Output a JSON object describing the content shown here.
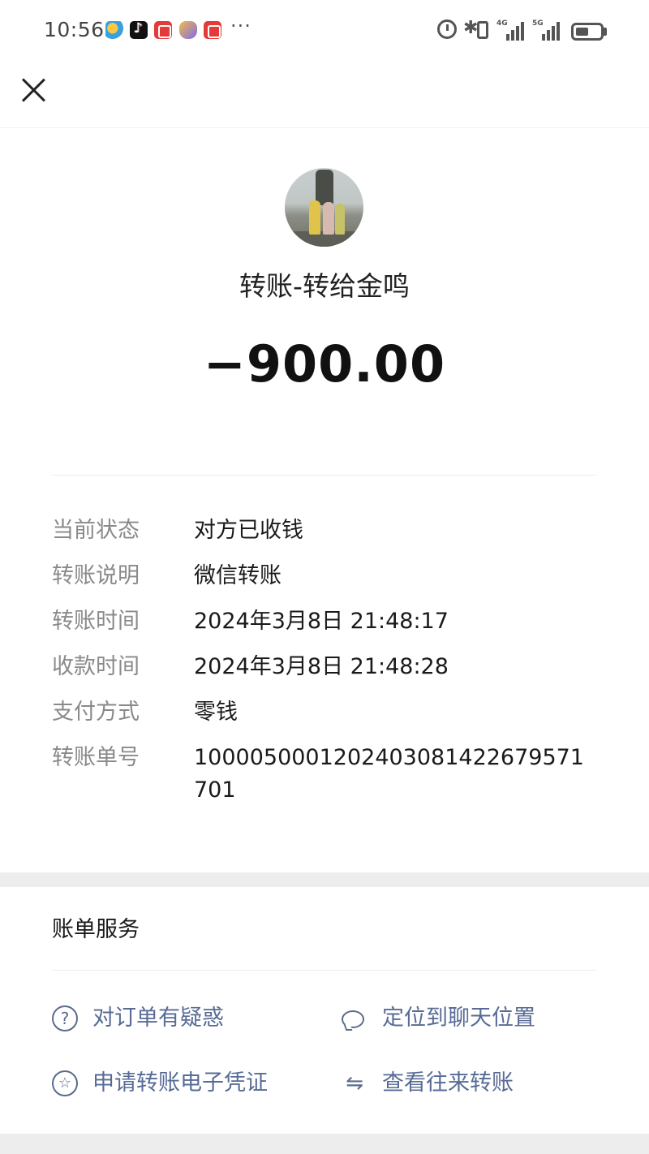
{
  "status_bar": {
    "time": "10:56",
    "more": "···",
    "network_1": "4G",
    "network_2": "5G",
    "notification_icons": [
      "app-icon",
      "tiktok-icon",
      "app-icon",
      "game-icon",
      "app-icon"
    ],
    "battery_level": 0.55
  },
  "header": {
    "close_icon": "close-icon"
  },
  "transfer": {
    "title": "转账-转给金鸣",
    "amount": "−900.00"
  },
  "details": [
    {
      "label": "当前状态",
      "value": "对方已收钱"
    },
    {
      "label": "转账说明",
      "value": "微信转账"
    },
    {
      "label": "转账时间",
      "value": "2024年3月8日 21:48:17"
    },
    {
      "label": "收款时间",
      "value": "2024年3月8日 21:48:28"
    },
    {
      "label": "支付方式",
      "value": "零钱"
    },
    {
      "label": "转账单号",
      "value": "1000050001202403081422679571701"
    }
  ],
  "services": {
    "title": "账单服务",
    "items": [
      {
        "label": "对订单有疑惑",
        "icon": "question-circle-icon",
        "glyph": "?"
      },
      {
        "label": "定位到聊天位置",
        "icon": "chat-bubble-icon",
        "glyph": ""
      },
      {
        "label": "申请转账电子凭证",
        "icon": "star-circle-icon",
        "glyph": "☆"
      },
      {
        "label": "查看往来转账",
        "icon": "swap-arrows-icon",
        "glyph": "⇋"
      }
    ]
  },
  "colors": {
    "link": "#576b95",
    "label_gray": "#8a8a8a",
    "band": "#ededed"
  }
}
